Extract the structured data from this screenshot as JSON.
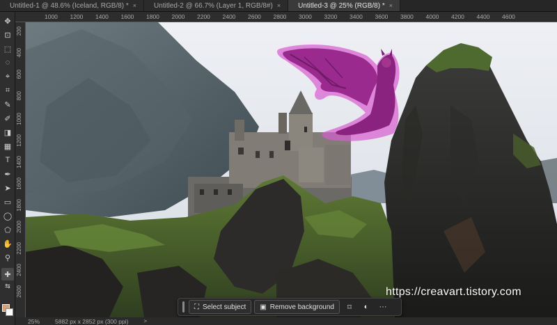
{
  "tabs": [
    {
      "label": "Untitled-1 @ 48.6% (Iceland, RGB/8) *",
      "close": "×"
    },
    {
      "label": "Untitled-2 @ 66.7% (Layer 1, RGB/8#)",
      "close": "×"
    },
    {
      "label": "Untitled-3 @ 25% (RGB/8) *",
      "close": "×",
      "active": true
    }
  ],
  "ruler": {
    "top": [
      "1000",
      "1200",
      "1400",
      "1600",
      "1800",
      "2000",
      "2200",
      "2400",
      "2600",
      "2800",
      "3000",
      "3200",
      "3400",
      "3600",
      "3800",
      "4000",
      "4200",
      "4400",
      "4600"
    ],
    "left": [
      "200",
      "400",
      "600",
      "800",
      "1000",
      "1200",
      "1400",
      "1600",
      "1800",
      "2000",
      "2200",
      "2400",
      "2600"
    ]
  },
  "toolbar": {
    "tools": [
      "move-icon",
      "artboard-icon",
      "marquee-icon",
      "lasso-icon",
      "object-select-icon",
      "crop-icon",
      "eyedropper-icon",
      "brush-icon",
      "eraser-icon",
      "gradient-icon",
      "type-icon",
      "pen-icon",
      "path-select-icon",
      "rectangle-icon",
      "ellipse-icon",
      "polygon-icon",
      "hand-icon",
      "zoom-icon",
      "spot-healing-icon"
    ],
    "foreground_color": "#d8a07a",
    "background_color": "#ffffff"
  },
  "taskbar": {
    "select_subject": "Select subject",
    "remove_background": "Remove background",
    "more": "···"
  },
  "watermark": "https://creavart.tistory.com",
  "status": {
    "zoom": "25%",
    "doc_info": "5882 px x 2852 px (300 ppi)",
    "arrow": ">"
  },
  "colors": {
    "dragon": "#9b2a8f",
    "dragon_glow": "#d85bd0",
    "sky": "#e3e6ec"
  }
}
